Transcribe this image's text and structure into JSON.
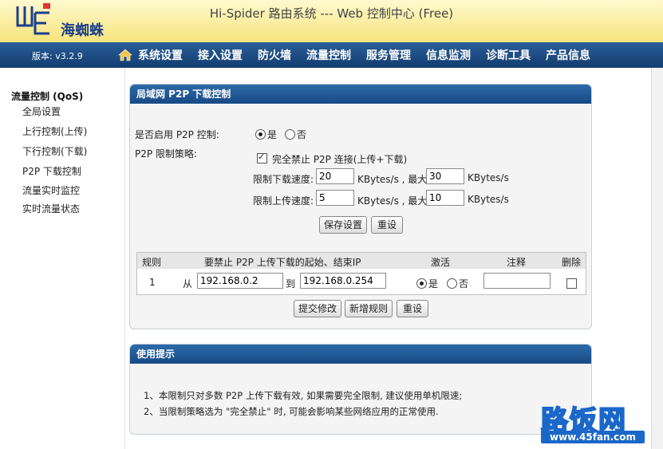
{
  "header": {
    "logo_text": "海蜘蛛",
    "title": "Hi-Spider 路由系统  --- Web 控制中心  (Free)"
  },
  "navbar": {
    "version": "版本: v3.2.9",
    "items": [
      "系统设置",
      "接入设置",
      "防火墙",
      "流量控制",
      "服务管理",
      "信息监测",
      "诊断工具",
      "产品信息"
    ]
  },
  "sidebar": {
    "header": "流量控制 (QoS)",
    "items": [
      "全局设置",
      "上行控制(上传)",
      "下行控制(下载)",
      "P2P 下载控制",
      "流量实时监控",
      "实时流量状态"
    ]
  },
  "p2p": {
    "panel_title": "局域网  P2P 下载控制",
    "enable_label": "是否启用  P2P 控制:",
    "yes": "是",
    "no": "否",
    "enabled": true,
    "policy_label": "P2P 限制策略:",
    "block_all_label": "完全禁止  P2P 连接(上传+下载)",
    "block_all_checked": true,
    "down_label": "限制下载速度:",
    "down_value": "20",
    "down_unit": "KBytes/s , 最大",
    "down_max": "30",
    "down_max_unit": "KBytes/s",
    "up_label": "限制上传速度:",
    "up_value": "5",
    "up_unit": "KBytes/s , 最大",
    "up_max": "10",
    "up_max_unit": "KBytes/s",
    "save_button": "保存设置",
    "reset_button": "重设"
  },
  "rules": {
    "headers": {
      "rule": "规则",
      "range": "要禁止  P2P 上传下载的起始、结束IP",
      "active": "激活",
      "note": "注释",
      "delete": "删除"
    },
    "rows": [
      {
        "num": "1",
        "from": "从",
        "start_ip": "192.168.0.2",
        "to": "到",
        "end_ip": "192.168.0.254",
        "yes": "是",
        "no": "否",
        "active": true,
        "note": "",
        "delete_checked": false
      }
    ],
    "submit_button": "提交修改",
    "add_button": "新增规则",
    "reset_button": "重设"
  },
  "tips": {
    "title": "使用提示",
    "lines": [
      "1、本限制只对多数  P2P 上传下载有效, 如果需要完全限制, 建议使用单机限速;",
      "2、当限制策略选为 \"完全禁止\" 时, 可能会影响某些网络应用的正常使用."
    ]
  },
  "watermark": {
    "big": "路饭网",
    "url": "www.45fan.com"
  },
  "colors": {
    "header_bg": "#f7e47a",
    "nav_bg": "#1a4a80",
    "panel_head": "#1f5a98",
    "watermark": "#1a67c9"
  }
}
